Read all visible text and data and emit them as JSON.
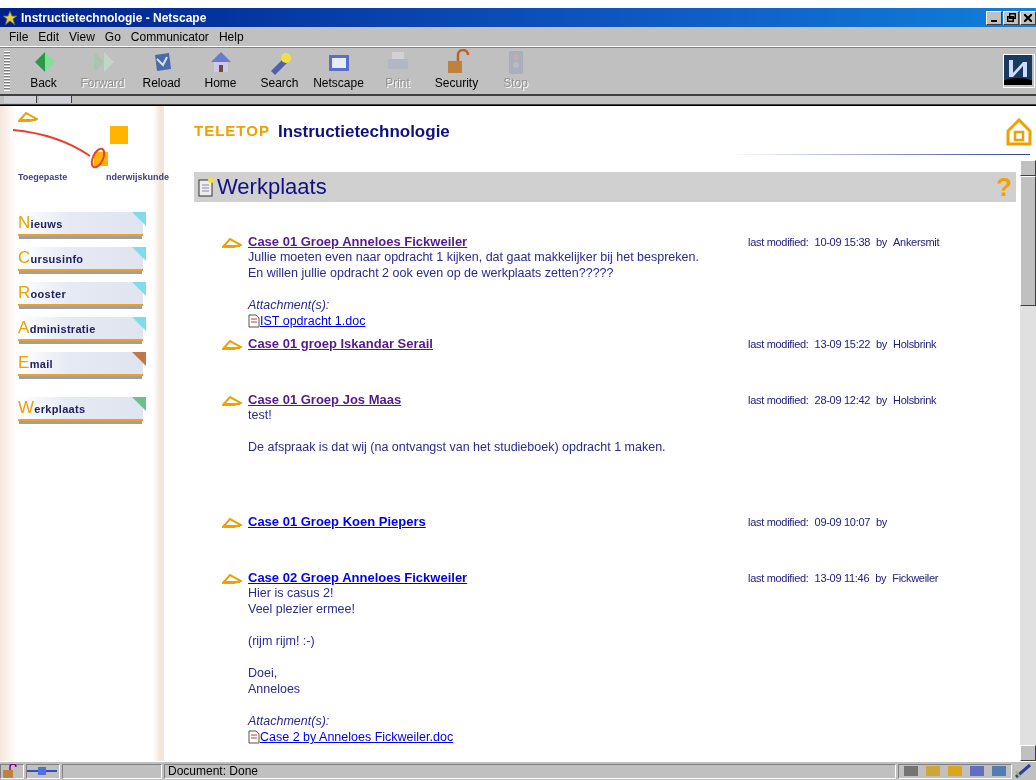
{
  "window": {
    "title": "Instructietechnologie - Netscape"
  },
  "menu": [
    "File",
    "Edit",
    "View",
    "Go",
    "Communicator",
    "Help"
  ],
  "toolbar": [
    {
      "label": "Back",
      "disabled": false
    },
    {
      "label": "Forward",
      "disabled": true
    },
    {
      "label": "Reload",
      "disabled": false
    },
    {
      "label": "Home",
      "disabled": false
    },
    {
      "label": "Search",
      "disabled": false
    },
    {
      "label": "Netscape",
      "disabled": false
    },
    {
      "label": "Print",
      "disabled": true
    },
    {
      "label": "Security",
      "disabled": false
    },
    {
      "label": "Stop",
      "disabled": true
    }
  ],
  "sidebar": {
    "logo": {
      "left": "Toegepaste",
      "right": "nderwijskunde"
    },
    "items": [
      {
        "label": "Nieuws",
        "color": "#7fdcec"
      },
      {
        "label": "Cursusinfo",
        "color": "#7fdcec"
      },
      {
        "label": "Rooster",
        "color": "#7fdcec"
      },
      {
        "label": "Administratie",
        "color": "#7fdcec"
      },
      {
        "label": "Email",
        "color": "#c0784a"
      },
      {
        "label": "Werkplaats",
        "color": "#6cc08a"
      }
    ]
  },
  "header": {
    "brand": "TELETOP",
    "title": "Instructietechnologie"
  },
  "section": {
    "title": "Werkplaats",
    "help": "?"
  },
  "posts": [
    {
      "title": "Case 01 Groep Anneloes Fickweiler",
      "visited": true,
      "meta_label": "last modified:",
      "date": "10-09 15:38",
      "by": "by",
      "author": "Ankersmit",
      "body": [
        [
          "Jullie moeten even naar opdracht 1 kijken, dat gaat makkelijker bij het bespreken.",
          "En willen jullie opdracht 2 ook even op de werkplaats zetten?????"
        ]
      ],
      "attachments_label": "Attachment(s):",
      "attachments": [
        "IST opdracht 1.doc"
      ]
    },
    {
      "title": "Case 01 groep Iskandar Serail",
      "visited": true,
      "meta_label": "last modified:",
      "date": "13-09 15:22",
      "by": "by",
      "author": "Holsbrink"
    },
    {
      "title": "Case 01 Groep Jos Maas",
      "visited": true,
      "meta_label": "last modified:",
      "date": "28-09 12:42",
      "by": "by",
      "author": "Holsbrink",
      "body": [
        [
          "test!"
        ],
        [
          "De afspraak is dat wij (na ontvangst van het studieboek) opdracht 1 maken."
        ]
      ]
    },
    {
      "title": "Case 01 Groep Koen Piepers",
      "visited": false,
      "meta_label": "last modified:",
      "date": "09-09 10:07",
      "by": "by"
    },
    {
      "title": "Case 02 Groep Anneloes Fickweiler",
      "visited": false,
      "meta_label": "last modified:",
      "date": "13-09 11:46",
      "by": "by",
      "author": "Fickweiler",
      "body": [
        [
          "Hier is casus 2!",
          "Veel plezier ermee!"
        ],
        [
          "(rijm rijm! :-)"
        ],
        [
          "Doei,",
          "Anneloes"
        ]
      ],
      "attachments_label": "Attachment(s):",
      "attachments": [
        "Case 2 by Anneloes Fickweiler.doc"
      ]
    }
  ],
  "status_bar": {
    "text": "Document: Done"
  }
}
